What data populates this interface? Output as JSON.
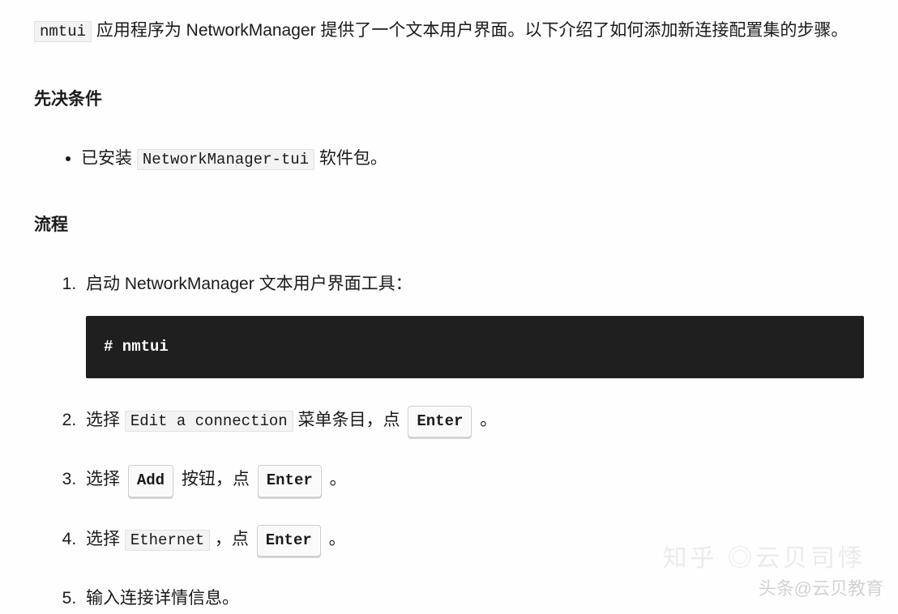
{
  "intro": {
    "code": "nmtui",
    "text_before": "",
    "text_after": " 应用程序为 NetworkManager 提供了一个文本用户界面。以下介绍了如何添加新连接配置集的步骤。"
  },
  "prereq": {
    "title": "先决条件",
    "item_prefix": "已安装 ",
    "item_code": "NetworkManager-tui",
    "item_suffix": " 软件包。"
  },
  "process": {
    "title": "流程",
    "step1": {
      "text": "启动 NetworkManager 文本用户界面工具：",
      "code": "# nmtui"
    },
    "step2": {
      "t1": "选择 ",
      "code1": "Edit a connection",
      "t2": " 菜单条目，点 ",
      "key": "Enter",
      "t3": " 。"
    },
    "step3": {
      "t1": "选择 ",
      "key1": "Add",
      "t2": " 按钮，点 ",
      "key2": "Enter",
      "t3": " 。"
    },
    "step4": {
      "t1": "选择 ",
      "code1": "Ethernet",
      "t2": " ，点 ",
      "key": "Enter",
      "t3": " 。"
    },
    "step5": {
      "text": "输入连接详情信息。"
    }
  },
  "watermark": {
    "line1": "知乎 ◎云贝司悸",
    "line2": "头条@云贝教育"
  }
}
